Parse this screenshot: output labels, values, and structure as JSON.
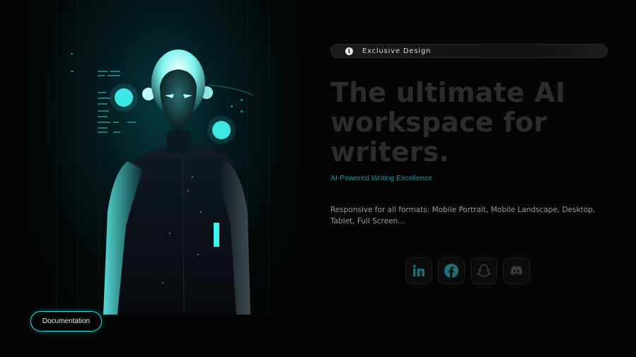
{
  "hero": {
    "badge_icon": "info-icon",
    "badge_label": "Exclusive Design",
    "title": "The ultimate AI workspace for writers.",
    "subtitle": "AI-Powered Writing Excellence",
    "description": "Responsive for all formats: Mobile Portrait, Mobile Landscape, Desktop, Tablet, Full Screen...",
    "accent_color": "#2fd6d6"
  },
  "documentation_button": {
    "label": "Documentation"
  },
  "socials": [
    {
      "icon": "linkedin-icon",
      "color": "#1f6f78"
    },
    {
      "icon": "facebook-icon",
      "color": "#1f6f78"
    },
    {
      "icon": "snapchat-icon",
      "color": "#3a3a3a"
    },
    {
      "icon": "discord-icon",
      "color": "#3a3a3a"
    }
  ]
}
